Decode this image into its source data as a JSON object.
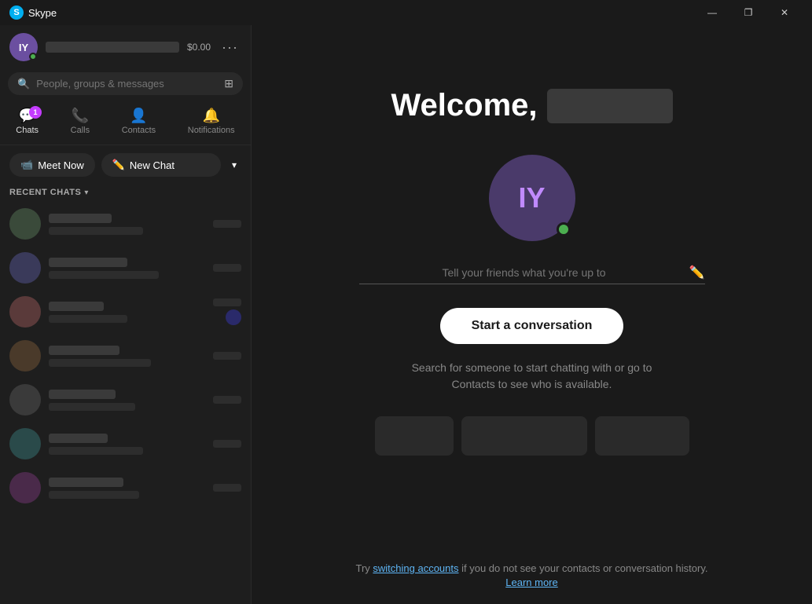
{
  "titlebar": {
    "app_name": "Skype",
    "minimize_label": "—",
    "restore_label": "❐",
    "close_label": "✕"
  },
  "sidebar": {
    "profile": {
      "initials": "IY",
      "credit": "$0.00"
    },
    "search": {
      "placeholder": "People, groups & messages"
    },
    "nav": {
      "tabs": [
        {
          "id": "chats",
          "label": "Chats",
          "icon": "💬",
          "badge": "1",
          "active": true
        },
        {
          "id": "calls",
          "label": "Calls",
          "icon": "📞",
          "badge": null,
          "active": false
        },
        {
          "id": "contacts",
          "label": "Contacts",
          "icon": "👤",
          "badge": null,
          "active": false
        },
        {
          "id": "notifications",
          "label": "Notifications",
          "icon": "🔔",
          "badge": null,
          "active": false
        }
      ]
    },
    "actions": {
      "meet_now_label": "Meet Now",
      "new_chat_label": "New Chat"
    },
    "recent_chats_label": "RECENT CHATS"
  },
  "main": {
    "welcome_text": "Welcome,",
    "avatar_initials": "IY",
    "status_placeholder": "Tell your friends what you're up to",
    "start_conversation_label": "Start a conversation",
    "search_hint": "Search for someone to start chatting with or go to Contacts to see who is available.",
    "bottom_hint": "Try ",
    "switching_accounts_label": "switching accounts",
    "bottom_hint_end": " if you do not see your contacts or conversation history.",
    "learn_more_label": "Learn more"
  }
}
